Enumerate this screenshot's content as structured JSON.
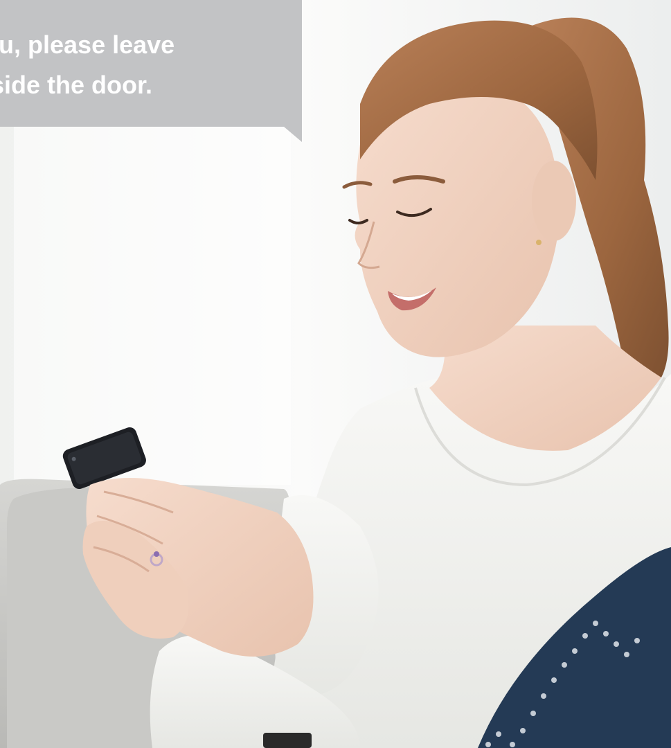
{
  "speech_bubble": {
    "line_1": "you, please leave",
    "line_2": "outside the door."
  },
  "photo": {
    "colors": {
      "background": "#f6f6f4",
      "bubble": "#c2c3c5",
      "bubble_text": "#ffffff",
      "hair": "#a8714a",
      "skin": "#efd2c1",
      "shirt": "#f4f4f1",
      "sofa": "#cfcfcc",
      "phone": "#1d1f24",
      "pillow": "#243a55"
    }
  }
}
